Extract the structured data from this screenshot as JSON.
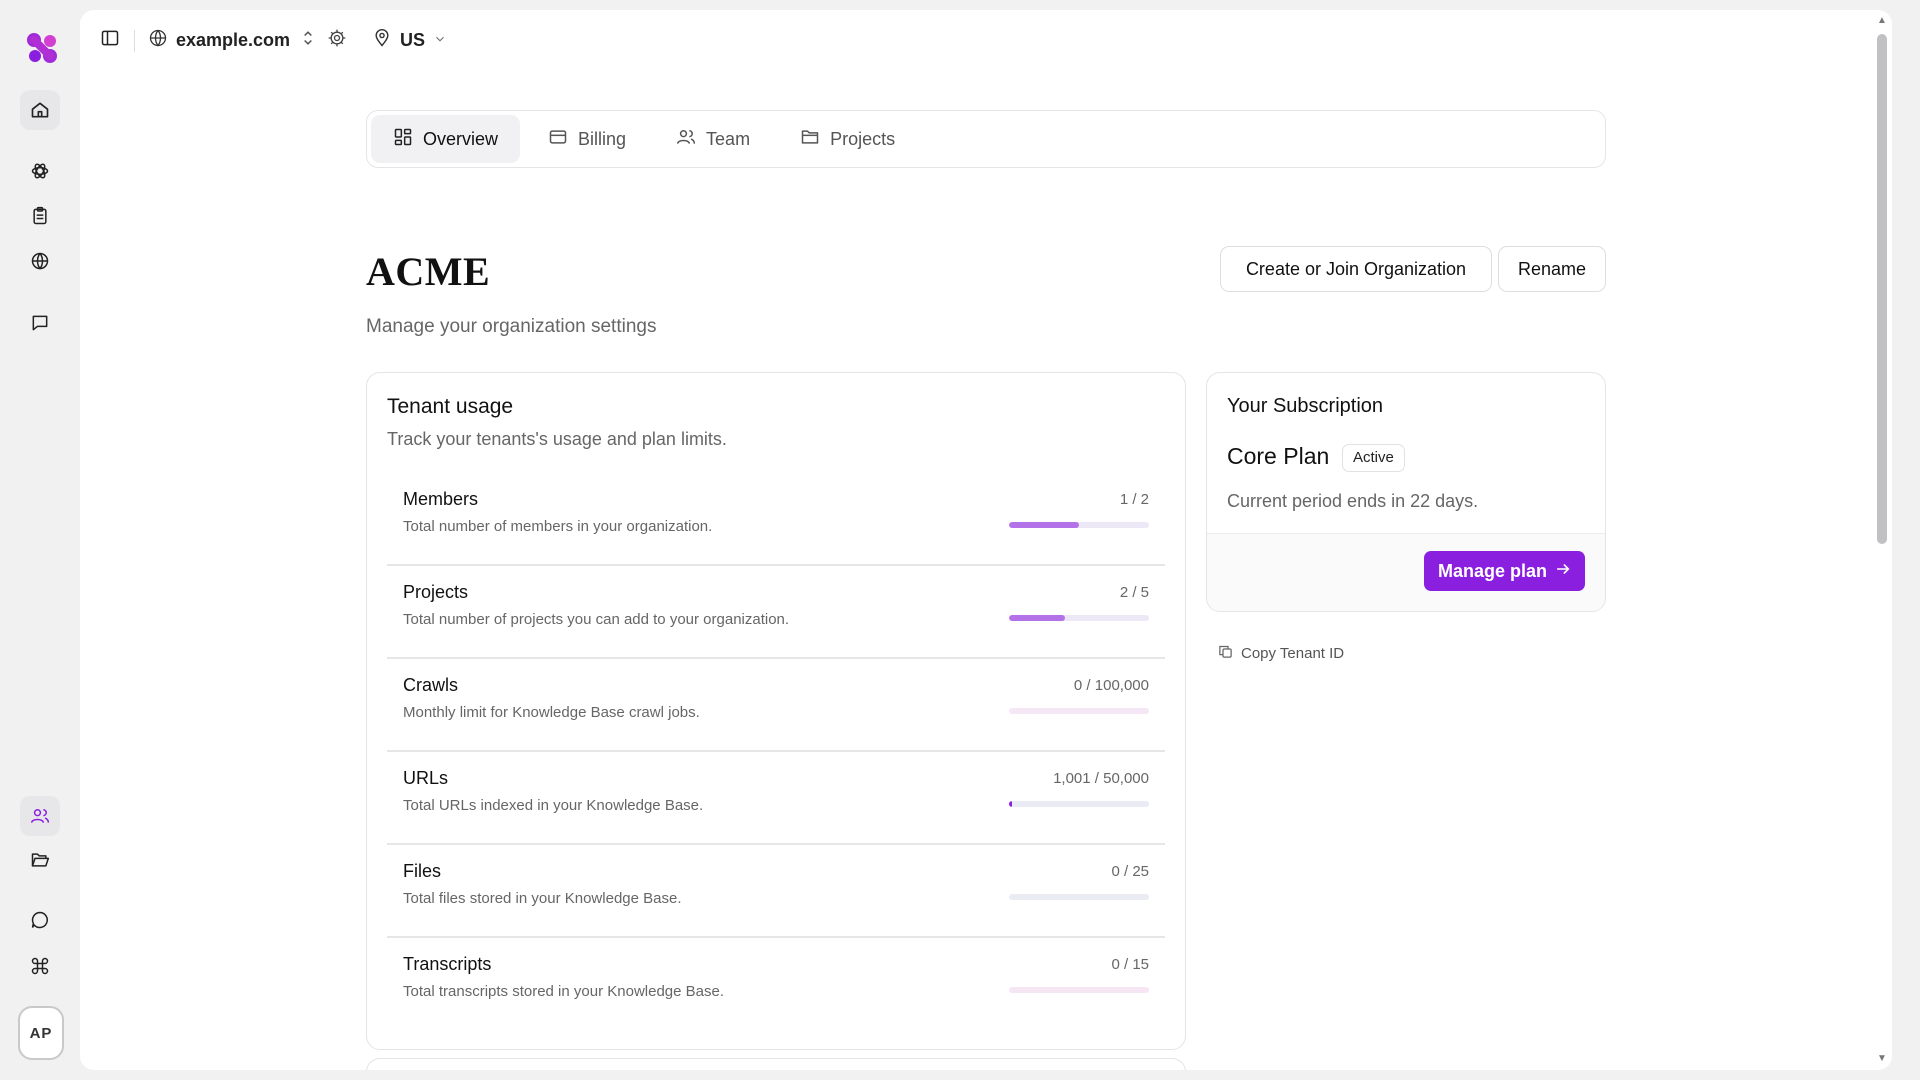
{
  "topbar": {
    "site": "example.com",
    "region": "US"
  },
  "tabs": [
    {
      "label": "Overview",
      "icon": "grid-icon",
      "active": true
    },
    {
      "label": "Billing",
      "icon": "credit-card-icon",
      "active": false
    },
    {
      "label": "Team",
      "icon": "users-icon",
      "active": false
    },
    {
      "label": "Projects",
      "icon": "folder-icon",
      "active": false
    }
  ],
  "header": {
    "title": "ACME",
    "subtitle": "Manage your organization settings",
    "create_join_label": "Create or Join Organization",
    "rename_label": "Rename"
  },
  "usage": {
    "title": "Tenant usage",
    "description": "Track your tenants's usage and plan limits.",
    "rows": [
      {
        "name": "Members",
        "description": "Total number of members in your organization.",
        "count": "1 / 2",
        "fraction": 0.5
      },
      {
        "name": "Projects",
        "description": "Total number of projects you can add to your organization.",
        "count": "2 / 5",
        "fraction": 0.4
      },
      {
        "name": "Crawls",
        "description": "Monthly limit for Knowledge Base crawl jobs.",
        "count": "0 / 100,000",
        "fraction": 0
      },
      {
        "name": "URLs",
        "description": "Total URLs indexed in your Knowledge Base.",
        "count": "1,001 / 50,000",
        "fraction": 0.02
      },
      {
        "name": "Files",
        "description": "Total files stored in your Knowledge Base.",
        "count": "0 / 25",
        "fraction": 0
      },
      {
        "name": "Transcripts",
        "description": "Total transcripts stored in your Knowledge Base.",
        "count": "0 / 15",
        "fraction": 0
      }
    ]
  },
  "subscription": {
    "title": "Your Subscription",
    "plan": "Core Plan",
    "status": "Active",
    "period": "Current period ends in 22 days.",
    "manage_label": "Manage plan"
  },
  "copy_tenant_label": "Copy Tenant ID",
  "user": {
    "initials": "AP"
  },
  "colors": {
    "accent": "#8a1fe0",
    "progress": "#b372e8",
    "progress_track": "#ece8f6"
  }
}
